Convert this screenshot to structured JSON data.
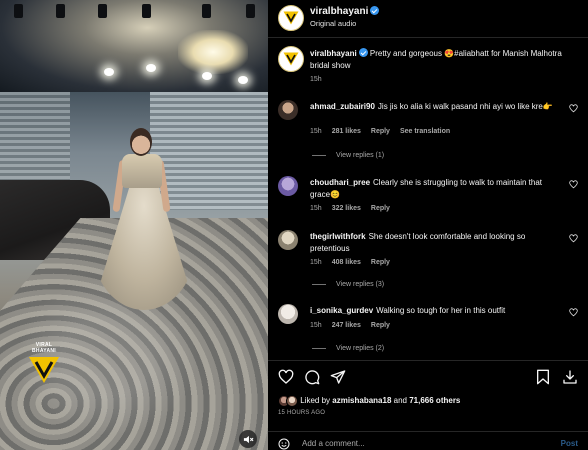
{
  "post": {
    "username": "viralbhayani",
    "audio_label": "Original audio",
    "watermark_text": "VIRAL BHAYANI",
    "caption": {
      "username": "viralbhayani",
      "text": "Pretty and gorgeous 😍#aliabhatt for Manish Malhotra bridal show",
      "time": "15h"
    }
  },
  "comments": [
    {
      "username": "ahmad_zubairi90",
      "text": "Jis jis ko alia ki walk pasand nhi ayi wo like kre👉",
      "time": "15h",
      "likes": "281 likes",
      "reply": "Reply",
      "translate": "See translation",
      "view_replies": "View replies (1)"
    },
    {
      "username": "choudhari_pree",
      "text": "Clearly she is struggling to walk to maintain that grace😊",
      "time": "15h",
      "likes": "322 likes",
      "reply": "Reply"
    },
    {
      "username": "thegirlwithfork",
      "text": "She doesn't look comfortable and looking so pretentious",
      "time": "15h",
      "likes": "408 likes",
      "reply": "Reply",
      "view_replies": "View replies (3)"
    },
    {
      "username": "i_sonika_gurdev",
      "text": "Walking so tough for her in this outfit",
      "time": "15h",
      "likes": "247 likes",
      "reply": "Reply",
      "view_replies": "View replies (2)"
    }
  ],
  "actions": {
    "liked_by_prefix": "Liked by",
    "liked_by_user": "azmishabana18",
    "liked_by_and": "and",
    "liked_by_others": "71,666 others",
    "time_ago": "15 HOURS AGO"
  },
  "add_comment": {
    "placeholder": "Add a comment...",
    "post_label": "Post"
  },
  "colors": {
    "background": "#000000",
    "verified": "#3897f0",
    "muted_text": "#a8a8a8",
    "post_button": "#2a5b8a",
    "brand_logo": "#f2c200"
  }
}
